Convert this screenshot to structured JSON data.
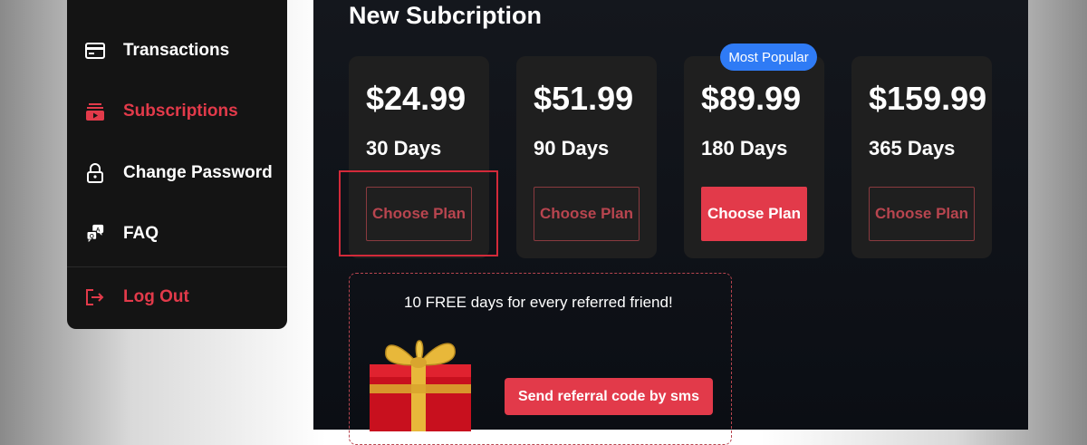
{
  "sidebar": {
    "items": [
      {
        "label": "Transactions",
        "icon": "credit-card-icon"
      },
      {
        "label": "Subscriptions",
        "icon": "subscriptions-icon",
        "active": true
      },
      {
        "label": "Change Password",
        "icon": "lock-icon"
      },
      {
        "label": "FAQ",
        "icon": "faq-chat-icon"
      }
    ],
    "logout": {
      "label": "Log Out",
      "icon": "logout-icon"
    }
  },
  "main": {
    "title": "New Subcription",
    "badge": "Most Popular",
    "plans": [
      {
        "price": "$24.99",
        "duration": "30 Days",
        "button": "Choose Plan"
      },
      {
        "price": "$51.99",
        "duration": "90 Days",
        "button": "Choose Plan"
      },
      {
        "price": "$89.99",
        "duration": "180 Days",
        "button": "Choose Plan"
      },
      {
        "price": "$159.99",
        "duration": "365 Days",
        "button": "Choose Plan"
      }
    ],
    "referral": {
      "text": "10 FREE days for every referred friend!",
      "button": "Send referral code by sms",
      "image": "gift-box-icon"
    }
  },
  "colors": {
    "accent": "#e23a4a",
    "badge": "#2f7bf5",
    "sidebar_bg": "#141414",
    "panel_bg": "#0f1218",
    "card_bg": "#1f1f1f"
  }
}
